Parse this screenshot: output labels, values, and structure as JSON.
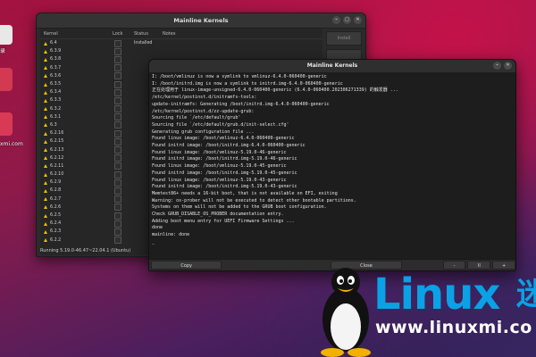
{
  "desktop": {
    "icons": [
      {
        "name": "folder",
        "label": "录"
      },
      {
        "name": "app",
        "label": ""
      },
      {
        "name": "app2",
        "label": "xmi.com"
      }
    ]
  },
  "main_window": {
    "title": "Mainline Kernels",
    "headers": {
      "kernel": "Kernel",
      "lock": "Lock",
      "status": "Status",
      "notes": "Notes"
    },
    "rows": [
      {
        "kernel": "6.4",
        "status": "Installed"
      },
      {
        "kernel": "6.3.9",
        "status": ""
      },
      {
        "kernel": "6.3.8",
        "status": ""
      },
      {
        "kernel": "6.3.7",
        "status": ""
      },
      {
        "kernel": "6.3.6",
        "status": ""
      },
      {
        "kernel": "6.3.5",
        "status": ""
      },
      {
        "kernel": "6.3.4",
        "status": ""
      },
      {
        "kernel": "6.3.3",
        "status": ""
      },
      {
        "kernel": "6.3.2",
        "status": ""
      },
      {
        "kernel": "6.3.1",
        "status": ""
      },
      {
        "kernel": "6.3",
        "status": ""
      },
      {
        "kernel": "6.2.16",
        "status": ""
      },
      {
        "kernel": "6.2.15",
        "status": ""
      },
      {
        "kernel": "6.2.13",
        "status": ""
      },
      {
        "kernel": "6.2.12",
        "status": ""
      },
      {
        "kernel": "6.2.11",
        "status": ""
      },
      {
        "kernel": "6.2.10",
        "status": ""
      },
      {
        "kernel": "6.2.9",
        "status": ""
      },
      {
        "kernel": "6.2.8",
        "status": ""
      },
      {
        "kernel": "6.2.7",
        "status": ""
      },
      {
        "kernel": "6.2.6",
        "status": ""
      },
      {
        "kernel": "6.2.5",
        "status": ""
      },
      {
        "kernel": "6.2.4",
        "status": ""
      },
      {
        "kernel": "6.2.3",
        "status": ""
      },
      {
        "kernel": "6.2.2",
        "status": ""
      }
    ],
    "side_buttons": [
      "Install",
      "",
      "",
      "",
      "",
      "",
      ""
    ],
    "status_bar": "Running 5.19.0-46.47~22.04.1 (Ubuntu)"
  },
  "terminal": {
    "title": "Mainline Kernels",
    "lines": [
      "I: /boot/vmlinuz is now a symlink to vmlinuz-6.4.0-060400-generic",
      "I: /boot/initrd.img is now a symlink to initrd.img-6.4.0-060400-generic",
      "正在处理用于 linux-image-unsigned-6.4.0-060400-generic (6.4.0-060400.202306271339) 的触发器 ...",
      "/etc/kernel/postinst.d/initramfs-tools:",
      "update-initramfs: Generating /boot/initrd.img-6.4.0-060400-generic",
      "/etc/kernel/postinst.d/zz-update-grub:",
      "Sourcing file `/etc/default/grub'",
      "Sourcing file `/etc/default/grub.d/init-select.cfg'",
      "Generating grub configuration file ...",
      "Found linux image: /boot/vmlinuz-6.4.0-060400-generic",
      "Found initrd image: /boot/initrd.img-6.4.0-060400-generic",
      "Found linux image: /boot/vmlinuz-5.19.0-46-generic",
      "Found initrd image: /boot/initrd.img-5.19.0-46-generic",
      "Found linux image: /boot/vmlinuz-5.19.0-45-generic",
      "Found initrd image: /boot/initrd.img-5.19.0-45-generic",
      "Found linux image: /boot/vmlinuz-5.19.0-43-generic",
      "Found initrd image: /boot/initrd.img-5.19.0-43-generic",
      "Memtest86+ needs a 16-bit boot, that is not available on EFI, exiting",
      "Warning: os-prober will not be executed to detect other bootable partitions.",
      "Systems on them will not be added to the GRUB boot configuration.",
      "Check GRUB_DISABLE_OS_PROBER documentation entry.",
      "Adding boot menu entry for UEFI Firmware Settings ...",
      "done",
      "mainline: done",
      ""
    ],
    "buttons": {
      "copy": "Copy",
      "close": "Close",
      "minus": "-",
      "pause": "II",
      "plus": "+"
    }
  },
  "watermark": {
    "linux": "Linux",
    "cn": "迷",
    "url": "www.linuxmi.co"
  }
}
